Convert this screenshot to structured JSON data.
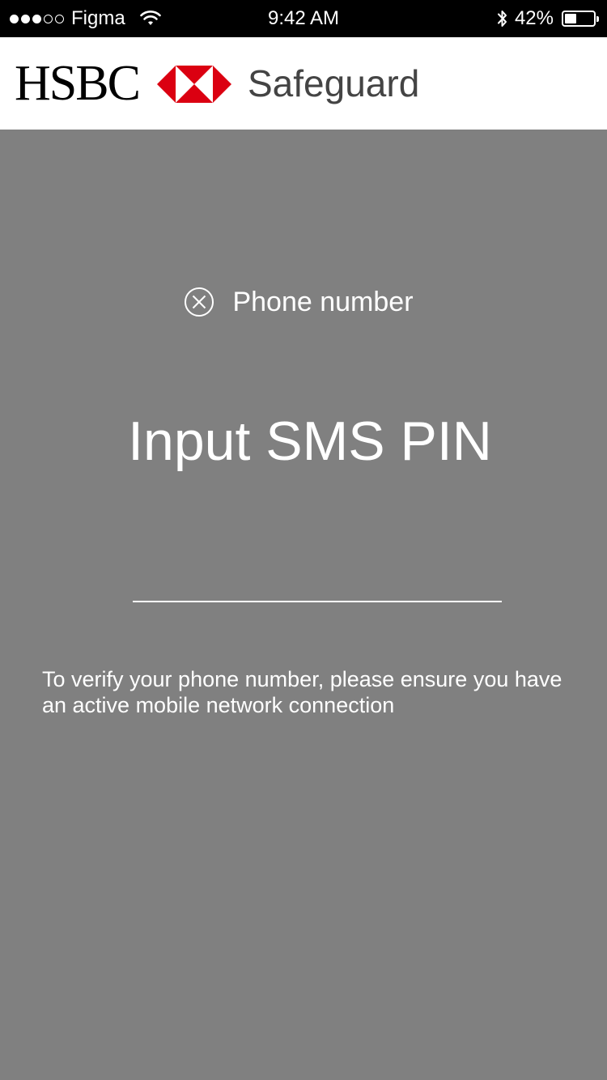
{
  "status_bar": {
    "signal_filled": 3,
    "signal_empty": 2,
    "carrier": "Figma",
    "time": "9:42 AM",
    "battery_percent": "42%",
    "battery_level": 0.42
  },
  "header": {
    "brand": "HSBC",
    "app_title": "Safeguard",
    "brand_color": "#db0011"
  },
  "phone_field": {
    "label": "Phone number",
    "icon": "close-circle-icon"
  },
  "main": {
    "title": "Input SMS PIN",
    "pin_value": "",
    "helper_text": "To verify your phone number, please ensure you have an active mobile network connection"
  },
  "colors": {
    "background": "#808080",
    "status_bar": "#000000",
    "header_bg": "#ffffff",
    "text": "#ffffff"
  }
}
